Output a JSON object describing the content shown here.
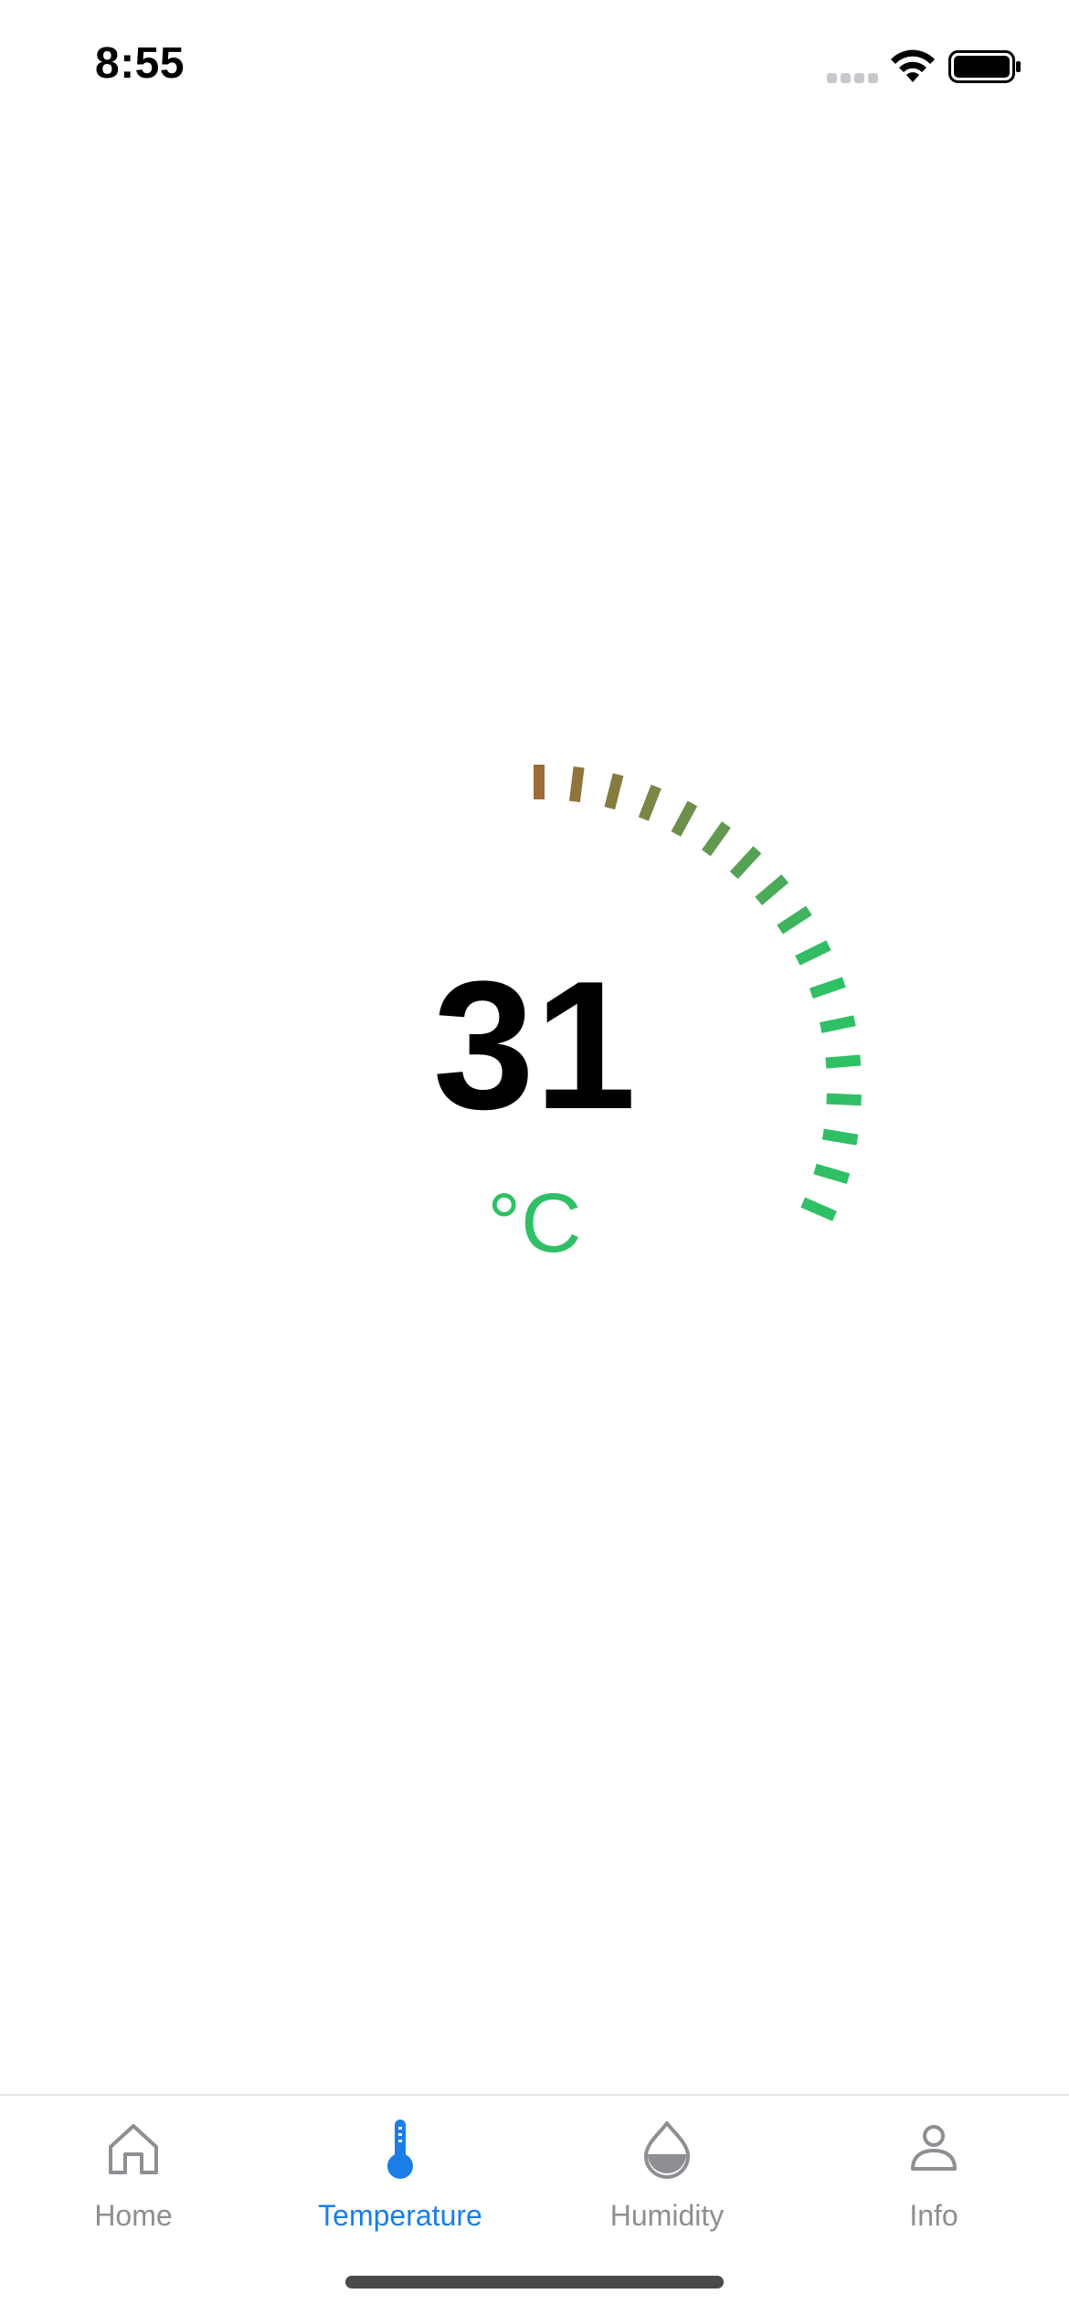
{
  "status_bar": {
    "time": "8:55"
  },
  "gauge": {
    "value": "31",
    "unit": "°C",
    "ticks_lit": 17,
    "colors": {
      "start": "#9c6b36",
      "end": "#2fc065"
    }
  },
  "tabs": [
    {
      "label": "Home",
      "icon": "home-icon",
      "active": false
    },
    {
      "label": "Temperature",
      "icon": "thermometer-icon",
      "active": true
    },
    {
      "label": "Humidity",
      "icon": "droplet-icon",
      "active": false
    },
    {
      "label": "Info",
      "icon": "person-icon",
      "active": false
    }
  ],
  "colors": {
    "accent": "#1a7ee6",
    "inactive": "#8e8e93",
    "gauge_green": "#2fc065"
  }
}
